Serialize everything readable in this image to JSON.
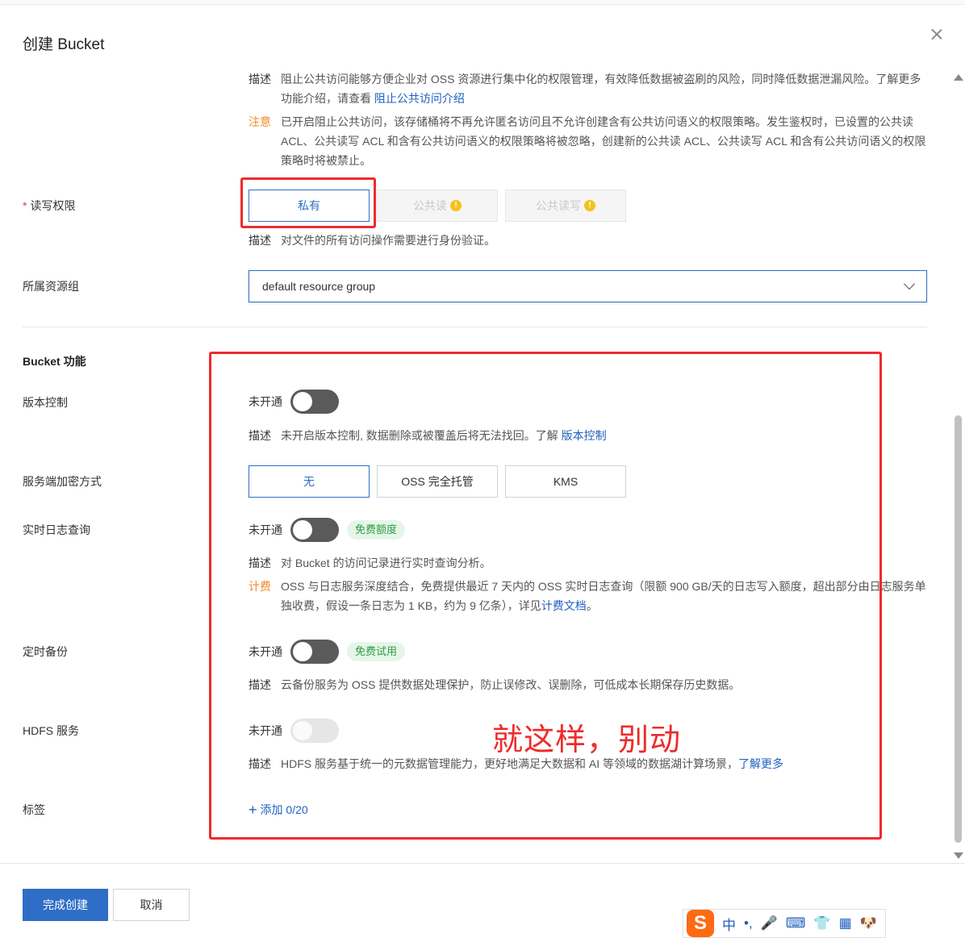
{
  "dialog": {
    "title": "创建 Bucket"
  },
  "public_access": {
    "desc_key": "描述",
    "desc_text": "阻止公共访问能够方便企业对 OSS 资源进行集中化的权限管理，有效降低数据被盗刷的风险，同时降低数据泄漏风险。了解更多功能介绍，请查看 ",
    "desc_link": "阻止公共访问介绍",
    "note_key": "注意",
    "note_text": "已开启阻止公共访问，该存储桶将不再允许匿名访问且不允许创建含有公共访问语义的权限策略。发生鉴权时，已设置的公共读 ACL、公共读写 ACL 和含有公共访问语义的权限策略将被忽略，创建新的公共读 ACL、公共读写 ACL 和含有公共访问语义的权限策略时将被禁止。"
  },
  "acl": {
    "required_mark": "*",
    "label": "读写权限",
    "options": [
      "私有",
      "公共读",
      "公共读写"
    ],
    "selected": "私有",
    "desc_key": "描述",
    "desc_text": "对文件的所有访问操作需要进行身份验证。"
  },
  "resource_group": {
    "label": "所属资源组",
    "value": "default resource group"
  },
  "features": {
    "section_title": "Bucket 功能",
    "versioning": {
      "label": "版本控制",
      "status": "未开通",
      "desc_key": "描述",
      "desc_text": "未开启版本控制, 数据删除或被覆盖后将无法找回。了解 ",
      "desc_link": "版本控制"
    },
    "encryption": {
      "label": "服务端加密方式",
      "options": [
        "无",
        "OSS 完全托管",
        "KMS"
      ],
      "selected": "无"
    },
    "realtime_log": {
      "label": "实时日志查询",
      "status": "未开通",
      "badge": "免费额度",
      "desc_key": "描述",
      "desc_text": "对 Bucket 的访问记录进行实时查询分析。",
      "billing_key": "计费",
      "billing_text": "OSS 与日志服务深度结合，免费提供最近 7 天内的 OSS 实时日志查询（限额 900 GB/天的日志写入额度，超出部分由日志服务单独收费，假设一条日志为 1 KB，约为 9 亿条），详见",
      "billing_link": "计费文档",
      "billing_end": "。"
    },
    "backup": {
      "label": "定时备份",
      "status": "未开通",
      "badge": "免费试用",
      "desc_key": "描述",
      "desc_text": "云备份服务为 OSS 提供数据处理保护，防止误修改、误删除，可低成本长期保存历史数据。"
    },
    "hdfs": {
      "label": "HDFS 服务",
      "status": "未开通",
      "desc_key": "描述",
      "desc_text": "HDFS 服务基于统一的元数据管理能力，更好地满足大数据和 AI 等领域的数据湖计算场景，",
      "desc_link": "了解更多"
    },
    "tags": {
      "label": "标签",
      "add_text": "添加 0/20"
    }
  },
  "annotation": {
    "text": "就这样，别动"
  },
  "footer": {
    "confirm_label": "完成创建",
    "cancel_label": "取消"
  },
  "ime_toolbar": {
    "logo": "S",
    "lang": "中",
    "punct": "•,"
  },
  "colors": {
    "primary": "#2f6ec6",
    "link": "#1f5fbf",
    "warning": "#f08a24",
    "annotation_red": "#ee2b2b",
    "badge_green": "#2f9a45"
  }
}
